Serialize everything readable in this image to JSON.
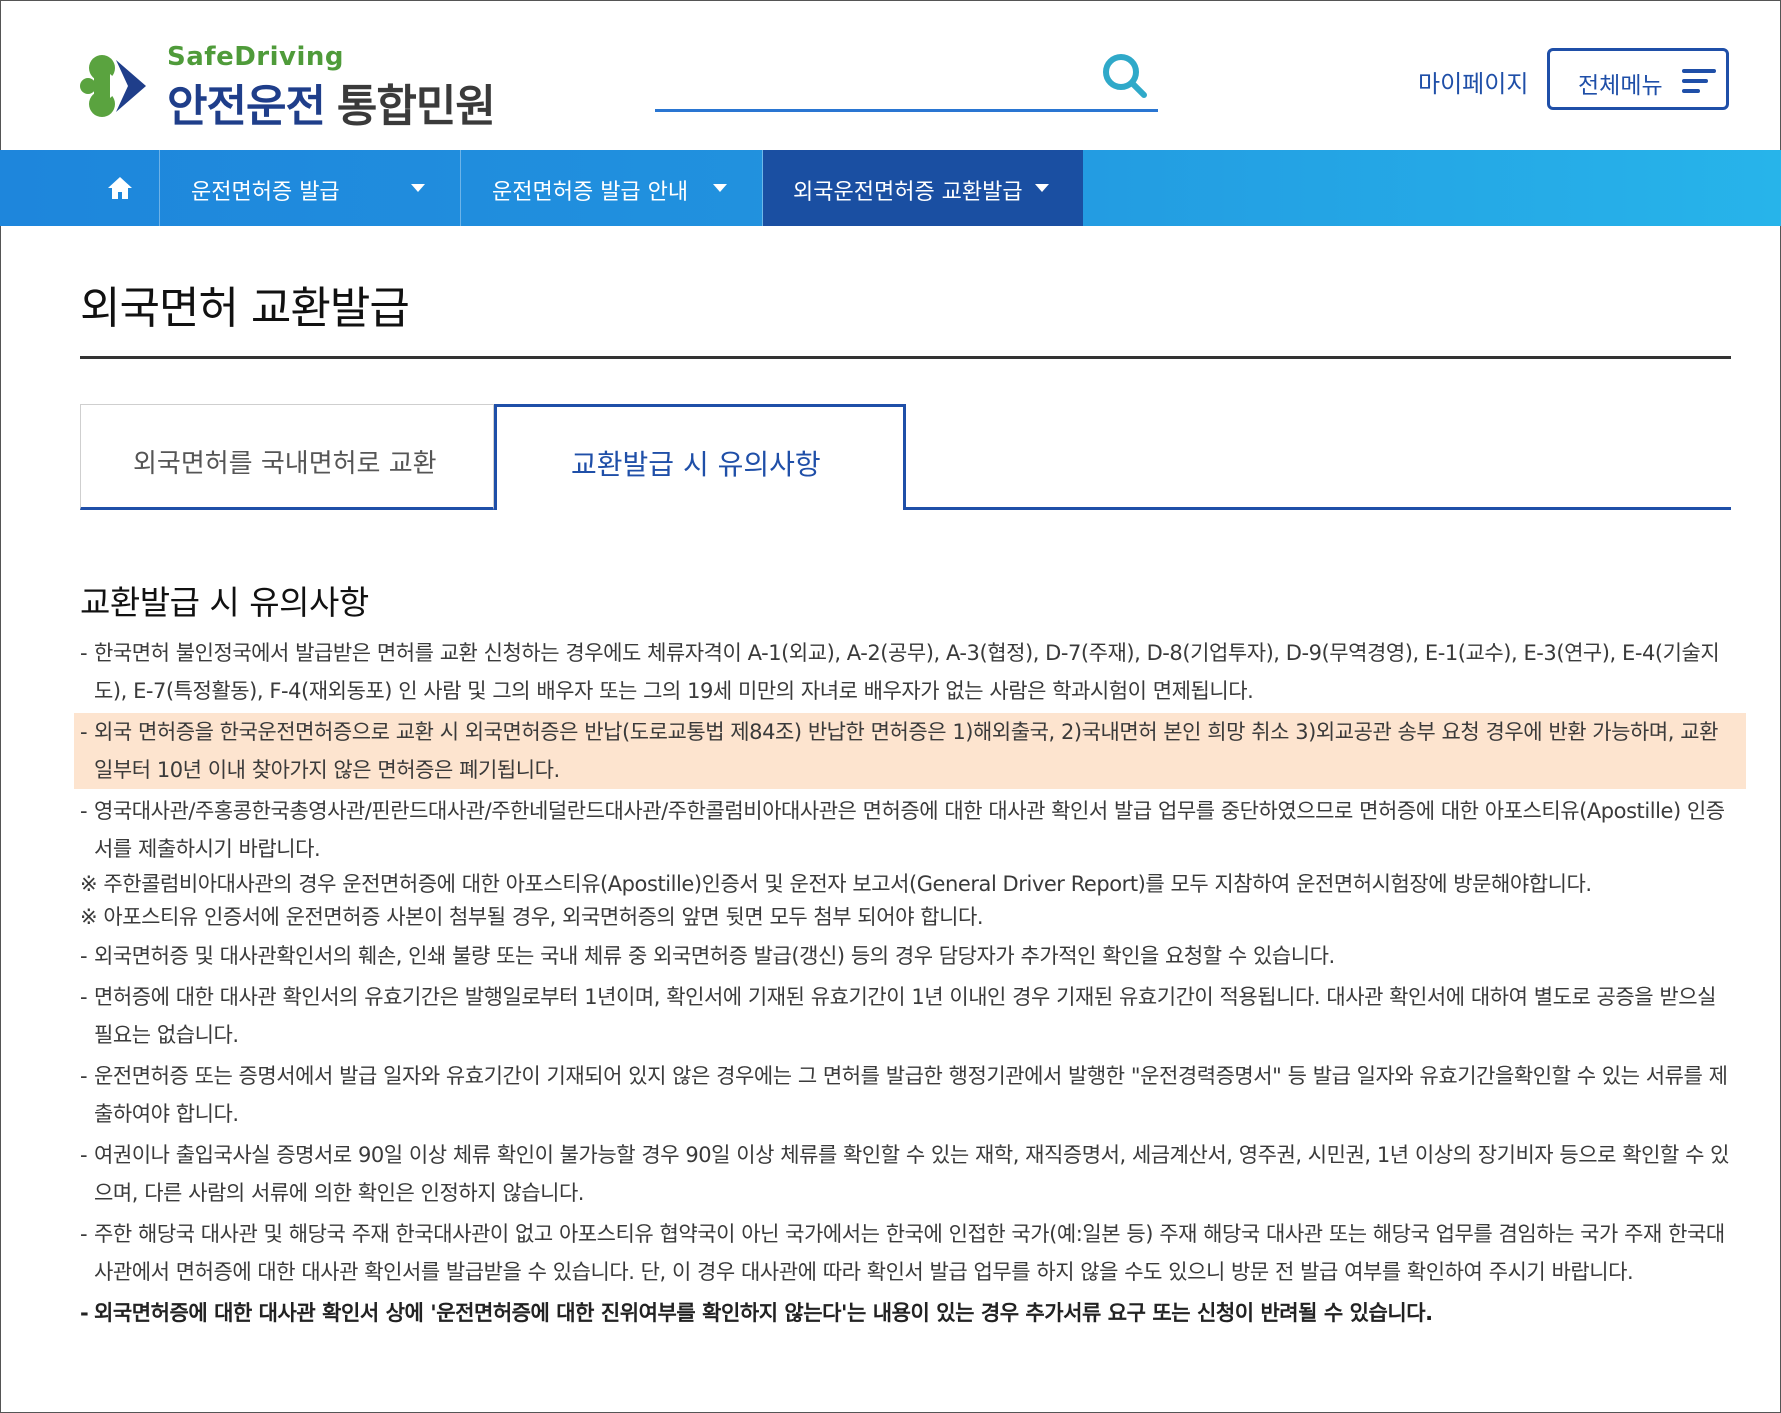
{
  "header": {
    "logo_sub": "SafeDriving",
    "logo_main": "안전운전",
    "logo_main_suffix": "통합민원",
    "search_placeholder": "",
    "search_icon": "search-icon",
    "mypage_label": "마이페이지",
    "allmenu_label": "전체메뉴",
    "colors": {
      "brand_blue": "#1f3e8a",
      "brand_green": "#4f9b3a",
      "accent": "#2a76d2"
    }
  },
  "nav": {
    "home_icon": "home-icon",
    "items": [
      {
        "label": "운전면허증 발급"
      },
      {
        "label": "운전면허증 발급 안내"
      },
      {
        "label": "외국운전면허증 교환발급"
      }
    ],
    "active_index": 2
  },
  "page": {
    "title": "외국면허 교환발급",
    "tabs": [
      {
        "label": "외국면허를 국내면허로 교환"
      },
      {
        "label": "교환발급 시 유의사항"
      }
    ],
    "active_tab": 1
  },
  "content": {
    "section_title": "교환발급 시 유의사항",
    "notes": [
      {
        "prefix": "- ",
        "text": "한국면허 불인정국에서 발급받은 면허를 교환 신청하는 경우에도 체류자격이 A-1(외교), A-2(공무), A-3(협정), D-7(주재), D-8(기업투자), D-9(무역경영), E-1(교수), E-3(연구), E-4(기술지도), E-7(특정활동), F-4(재외동포) 인 사람 및 그의 배우자 또는 그의 19세 미만의 자녀로 배우자가 없는 사람은 학과시험이 면제됩니다."
      },
      {
        "prefix": "- ",
        "text": "외국 면허증을 한국운전면허증으로 교환 시 외국면허증은 반납(도로교통법 제84조) 반납한 면허증은 1)해외출국, 2)국내면허 본인 희망 취소 3)외교공관 송부 요청 경우에 반환 가능하며, 교환일부터 10년 이내 찾아가지 않은 면허증은 폐기됩니다."
      },
      {
        "prefix": "- ",
        "text": "영국대사관/주홍콩한국총영사관/핀란드대사관/주한네덜란드대사관/주한콜럼비아대사관은 면허증에 대한 대사관 확인서 발급 업무를 중단하였으므로 면허증에 대한 아포스티유(Apostille) 인증서를 제출하시기 바랍니다."
      },
      {
        "prefix": "",
        "text": "※ 주한콜럼비아대사관의 경우 운전면허증에 대한 아포스티유(Apostille)인증서 및 운전자 보고서(General Driver Report)를 모두 지참하여 운전면허시험장에 방문해야합니다."
      },
      {
        "prefix": "",
        "text": "※ 아포스티유 인증서에 운전면허증 사본이 첨부될 경우, 외국면허증의 앞면 뒷면 모두 첨부 되어야 합니다."
      },
      {
        "prefix": "- ",
        "text": "외국면허증 및 대사관확인서의 훼손, 인쇄 불량 또는 국내 체류 중 외국면허증 발급(갱신) 등의 경우 담당자가 추가적인 확인을 요청할 수 있습니다."
      },
      {
        "prefix": "- ",
        "text": "면허증에 대한 대사관 확인서의 유효기간은 발행일로부터 1년이며, 확인서에 기재된 유효기간이 1년 이내인 경우 기재된 유효기간이 적용됩니다. 대사관 확인서에 대하여 별도로 공증을 받으실 필요는 없습니다."
      },
      {
        "prefix": "- ",
        "text": "운전면허증 또는 증명서에서 발급 일자와 유효기간이 기재되어 있지 않은 경우에는 그 면허를 발급한 행정기관에서 발행한 \"운전경력증명서\" 등 발급 일자와 유효기간을확인할 수 있는 서류를 제출하여야 합니다."
      },
      {
        "prefix": "- ",
        "text": "여권이나 출입국사실 증명서로 90일 이상 체류 확인이 불가능할 경우 90일 이상 체류를 확인할 수 있는 재학, 재직증명서, 세금계산서, 영주권, 시민권, 1년 이상의 장기비자 등으로 확인할 수 있으며, 다른 사람의 서류에 의한 확인은 인정하지 않습니다."
      },
      {
        "prefix": "- ",
        "text": "주한 해당국 대사관 및 해당국 주재 한국대사관이 없고 아포스티유 협약국이 아닌 국가에서는 한국에 인접한 국가(예:일본 등) 주재 해당국 대사관 또는 해당국 업무를 겸임하는 국가 주재 한국대사관에서 면허증에 대한 대사관 확인서를 발급받을 수 있습니다. 단, 이 경우 대사관에 따라 확인서 발급 업무를 하지 않을 수도 있으니 방문 전 발급 여부를 확인하여 주시기 바랍니다."
      },
      {
        "prefix": "- ",
        "text": "외국면허증에 대한 대사관 확인서 상에 '운전면허증에 대한 진위여부를 확인하지 않는다'는 내용이 있는 경우 추가서류 요구 또는 신청이 반려될 수 있습니다."
      }
    ],
    "highlight_color": "#fde4cf"
  }
}
